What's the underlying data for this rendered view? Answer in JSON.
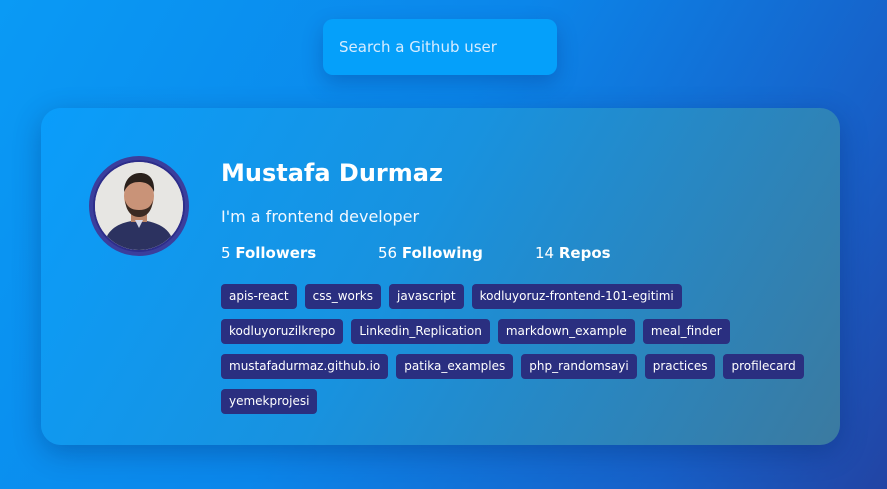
{
  "search": {
    "placeholder": "Search a Github user",
    "value": ""
  },
  "profile": {
    "name": "Mustafa Durmaz",
    "bio": "I'm a frontend developer",
    "stats": [
      {
        "count": "5",
        "label": "Followers"
      },
      {
        "count": "56",
        "label": "Following"
      },
      {
        "count": "14",
        "label": "Repos"
      }
    ],
    "repos": [
      "apis-react",
      "css_works",
      "javascript",
      "kodluyoruz-frontend-101-egitimi",
      "kodluyoruzilkrepo",
      "Linkedin_Replication",
      "markdown_example",
      "meal_finder",
      "mustafadurmaz.github.io",
      "patika_examples",
      "php_randomsayi",
      "practices",
      "profilecard",
      "yemekprojesi"
    ]
  },
  "colors": {
    "accent": "#05a0fa",
    "repo_tag": "#2a2f80",
    "avatar_ring": "#3b3e9c"
  }
}
